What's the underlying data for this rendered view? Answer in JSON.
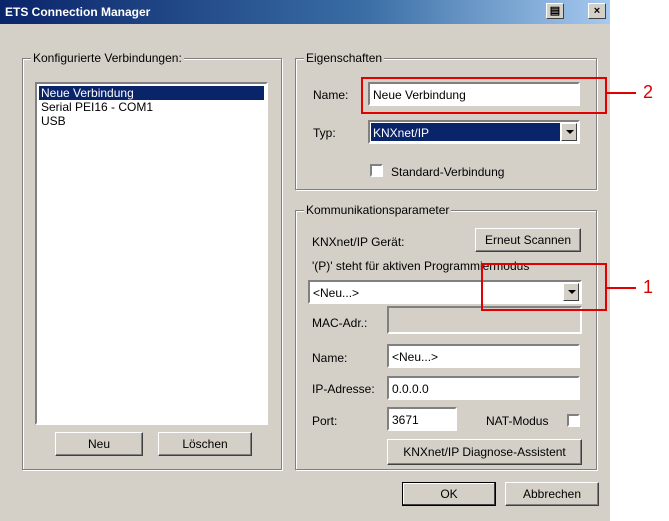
{
  "window": {
    "title": "ETS Connection Manager"
  },
  "connections": {
    "label": "Konfigurierte Verbindungen:",
    "items": [
      "Neue Verbindung",
      "Serial PEI16 - COM1",
      "USB"
    ],
    "selected_index": 0,
    "new_label": "Neu",
    "delete_label": "Löschen"
  },
  "properties": {
    "label": "Eigenschaften",
    "name_label": "Name:",
    "name_value": "Neue Verbindung",
    "type_label": "Typ:",
    "type_value": "KNXnet/IP",
    "standard_label": "Standard-Verbindung",
    "standard_checked": false
  },
  "comm": {
    "label": "Kommunikationsparameter",
    "device_label": "KNXnet/IP Gerät:",
    "rescan_label": "Erneut Scannen",
    "hint": "'(P)' steht für aktiven Programmiermodus",
    "device_value": "<Neu...>",
    "mac_label": "MAC-Adr.:",
    "mac_value": "",
    "name_label": "Name:",
    "name_value": "<Neu...>",
    "ip_label": "IP-Adresse:",
    "ip_value": "0.0.0.0",
    "port_label": "Port:",
    "port_value": "3671",
    "nat_label": "NAT-Modus",
    "nat_checked": false,
    "diag_label": "KNXnet/IP Diagnose-Assistent"
  },
  "footer": {
    "ok_label": "OK",
    "cancel_label": "Abbrechen"
  },
  "annotations": {
    "one": "1",
    "two": "2"
  },
  "colors": {
    "selection": "#0a246a",
    "annotation": "#e00000",
    "face": "#d4d0c8"
  }
}
